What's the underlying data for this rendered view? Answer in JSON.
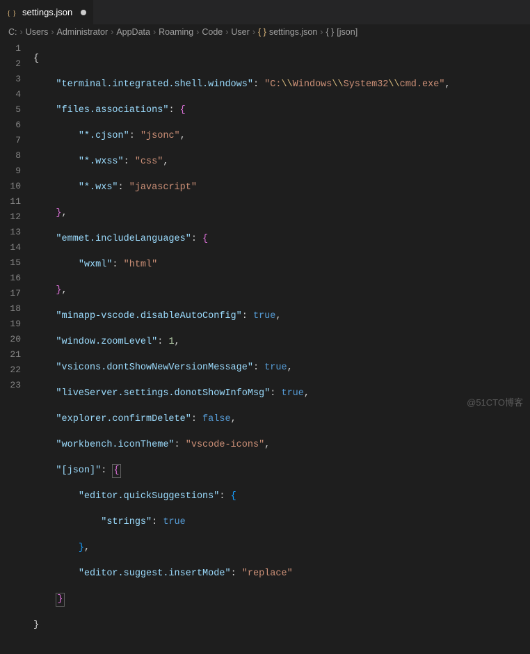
{
  "tab": {
    "filename": "settings.json",
    "modified": true
  },
  "breadcrumb": {
    "segments": [
      "C:",
      "Users",
      "Administrator",
      "AppData",
      "Roaming",
      "Code",
      "User"
    ],
    "file": "settings.json",
    "symbol": "[json]"
  },
  "gutter": {
    "start": 1,
    "end": 23
  },
  "code": {
    "l1": "{",
    "l2_k": "\"terminal.integrated.shell.windows\"",
    "l2_v_pre": "\"C:",
    "l2_esc1": "\\\\",
    "l2_mid1": "Windows",
    "l2_esc2": "\\\\",
    "l2_mid2": "System32",
    "l2_esc3": "\\\\",
    "l2_end": "cmd.exe\"",
    "l3_k": "\"files.associations\"",
    "l4_k": "\"*.cjson\"",
    "l4_v": "\"jsonc\"",
    "l5_k": "\"*.wxss\"",
    "l5_v": "\"css\"",
    "l6_k": "\"*.wxs\"",
    "l6_v": "\"javascript\"",
    "l8_k": "\"emmet.includeLanguages\"",
    "l9_k": "\"wxml\"",
    "l9_v": "\"html\"",
    "l11_k": "\"minapp-vscode.disableAutoConfig\"",
    "l11_v": "true",
    "l12_k": "\"window.zoomLevel\"",
    "l12_v": "1",
    "l13_k": "\"vsicons.dontShowNewVersionMessage\"",
    "l13_v": "true",
    "l14_k": "\"liveServer.settings.donotShowInfoMsg\"",
    "l14_v": "true",
    "l15_k": "\"explorer.confirmDelete\"",
    "l15_v": "false",
    "l16_k": "\"workbench.iconTheme\"",
    "l16_v": "\"vscode-icons\"",
    "l17_k": "\"[json]\"",
    "l18_k": "\"editor.quickSuggestions\"",
    "l19_k": "\"strings\"",
    "l19_v": "true",
    "l21_k": "\"editor.suggest.insertMode\"",
    "l21_v": "\"replace\""
  },
  "watermark": "@51CTO博客"
}
